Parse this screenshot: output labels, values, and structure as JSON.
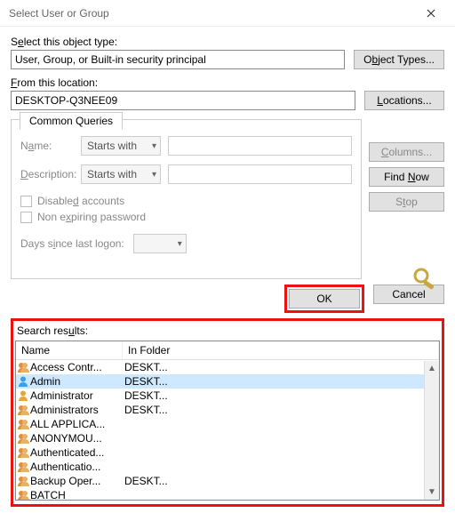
{
  "titlebar": {
    "title": "Select User or Group"
  },
  "objectType": {
    "label_pre": "S",
    "label_u": "e",
    "label_post": "lect this object type:",
    "value": "User, Group, or Built-in security principal",
    "button_pre": "O",
    "button_u": "b",
    "button_post": "ject Types..."
  },
  "location": {
    "label_pre": "",
    "label_u": "F",
    "label_post": "rom this location:",
    "value": "DESKTOP-Q3NEE09",
    "button_pre": "",
    "button_u": "L",
    "button_post": "ocations..."
  },
  "tab": {
    "label": "Common Queries"
  },
  "queries": {
    "name_u": "a",
    "name_label_pre": "N",
    "name_label_post": "me:",
    "desc_u": "D",
    "desc_label_post": "escription:",
    "starts_with": "Starts with",
    "disabled_pre": "Disable",
    "disabled_u": "d",
    "disabled_post": " accounts",
    "nonexp_pre": "Non e",
    "nonexp_u": "x",
    "nonexp_post": "piring password",
    "days_pre": "Days s",
    "days_u": "i",
    "days_post": "nce last logon:"
  },
  "sideButtons": {
    "columns_u": "C",
    "columns_post": "olumns...",
    "find_pre": "Find ",
    "find_u": "N",
    "find_post": "ow",
    "stop_pre": "S",
    "stop_u": "t",
    "stop_post": "op"
  },
  "dialogButtons": {
    "ok": "OK",
    "cancel": "Cancel"
  },
  "results": {
    "header_pre": "Search res",
    "header_u": "u",
    "header_post": "lts:",
    "columns": {
      "name": "Name",
      "folder": "In Folder"
    },
    "rows": [
      {
        "icon": "group",
        "name": "Access Contr...",
        "folder": "DESKT...",
        "selected": false
      },
      {
        "icon": "user",
        "name": "Admin",
        "folder": "DESKT...",
        "selected": true
      },
      {
        "icon": "admin",
        "name": "Administrator",
        "folder": "DESKT...",
        "selected": false
      },
      {
        "icon": "group",
        "name": "Administrators",
        "folder": "DESKT...",
        "selected": false
      },
      {
        "icon": "group",
        "name": "ALL APPLICA...",
        "folder": "",
        "selected": false
      },
      {
        "icon": "group",
        "name": "ANONYMOU...",
        "folder": "",
        "selected": false
      },
      {
        "icon": "group",
        "name": "Authenticated...",
        "folder": "",
        "selected": false
      },
      {
        "icon": "group",
        "name": "Authenticatio...",
        "folder": "",
        "selected": false
      },
      {
        "icon": "group",
        "name": "Backup Oper...",
        "folder": "DESKT...",
        "selected": false
      },
      {
        "icon": "group",
        "name": "BATCH",
        "folder": "",
        "selected": false
      }
    ]
  }
}
